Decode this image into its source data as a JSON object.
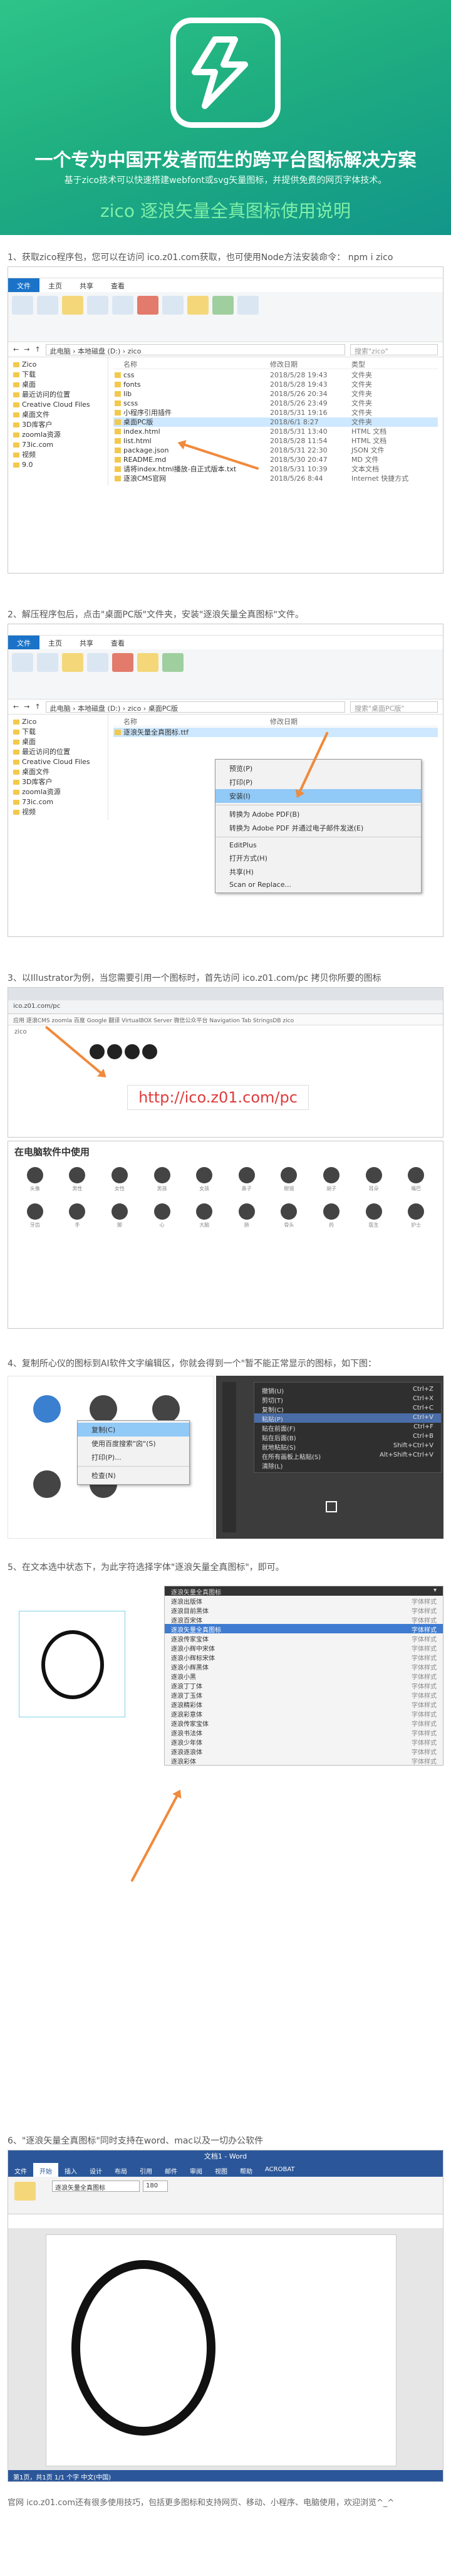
{
  "hero": {
    "title": "一个专为中国开发者而生的跨平台图标解决方案",
    "subtitle": "基于zico技术可以快速搭建webfont或svg矢量图标，并提供免费的网页字体技术。",
    "heading": "zico 逐浪矢量全真图标使用说明"
  },
  "steps": {
    "s1": "1、获取zico程序包，您可以在访问 ico.z01.com获取，也可使用Node方法安装命令： npm i zico",
    "s2": "2、解压程序包后，点击\"桌面PC版\"文件夹，安装\"逐浪矢量全真图标\"文件。",
    "s3": "3、以Illustrator为例，当您需要引用一个图标时，首先访问 ico.z01.com/pc 拷贝你所要的图标",
    "s4": "4、复制所心仪的图标到AI软件文字编辑区，你就会得到一个\"暂不能正常显示的图标，如下图：",
    "s5": "5、在文本选中状态下，为此字符选择字体\"逐浪矢量全真图标\"，即可。",
    "s6": "6、\"逐浪矢量全真图标\"同时支持在word、mac以及一切办公软件"
  },
  "explorer1": {
    "tabs": [
      "文件",
      "主页",
      "共享",
      "查看"
    ],
    "path": "此电脑 › 本地磁盘 (D:) › zico",
    "search": "搜索\"zico\"",
    "columns": [
      "名称",
      "修改日期",
      "类型"
    ],
    "nav": [
      "Zico",
      "下载",
      "桌面",
      "最近访问的位置",
      "Creative Cloud Files",
      "桌面文件",
      "3D库客户",
      "zoomla资源",
      "73ic.com",
      "视频",
      "9.0"
    ],
    "files": [
      {
        "name": "css",
        "date": "2018/5/28 19:43",
        "type": "文件夹"
      },
      {
        "name": "fonts",
        "date": "2018/5/28 19:43",
        "type": "文件夹"
      },
      {
        "name": "lib",
        "date": "2018/5/26 20:34",
        "type": "文件夹"
      },
      {
        "name": "scss",
        "date": "2018/5/26 23:49",
        "type": "文件夹"
      },
      {
        "name": "小程序引用插件",
        "date": "2018/5/31 19:16",
        "type": "文件夹"
      },
      {
        "name": "桌面PC版",
        "date": "2018/6/1 8:27",
        "type": "文件夹"
      },
      {
        "name": "index.html",
        "date": "2018/5/31 13:40",
        "type": "HTML 文档"
      },
      {
        "name": "list.html",
        "date": "2018/5/28 11:54",
        "type": "HTML 文档"
      },
      {
        "name": "package.json",
        "date": "2018/5/31 22:30",
        "type": "JSON 文件"
      },
      {
        "name": "README.md",
        "date": "2018/5/30 20:47",
        "type": "MD 文件"
      },
      {
        "name": "请将index.html播放-自正式版本.txt",
        "date": "2018/5/31 10:39",
        "type": "文本文档"
      },
      {
        "name": "逐浪CMS官网",
        "date": "2018/5/26 8:44",
        "type": "Internet 快捷方式"
      }
    ]
  },
  "explorer2": {
    "path": "此电脑 › 本地磁盘 (D:) › zico › 桌面PC版",
    "search": "搜索\"桌面PC版\"",
    "nav": [
      "Zico",
      "下载",
      "桌面",
      "最近访问的位置",
      "Creative Cloud Files",
      "桌面文件",
      "3D库客户",
      "zoomla资源",
      "73ic.com",
      "视频"
    ],
    "file": "逐浪矢量全真图标.ttf",
    "menu": [
      "预览(P)",
      "打印(P)",
      "安装(I)",
      "转换为 Adobe PDF(B)",
      "转换为 Adobe PDF 并通过电子邮件发送(E)",
      "EditPlus",
      "打开方式(H)",
      "共享(H)",
      "Scan or Replace..."
    ]
  },
  "browser": {
    "url": "ico.z01.com/pc",
    "bookmarks": "应用  逐浪CMS  zoomla  百度  Google 翻译  VirtualBOX Server  微信公众平台  Navigation Tab  StringsDB  zico",
    "badge": "http://ico.z01.com/pc",
    "section": "在电脑软件中使用",
    "icons": [
      "头像",
      "男性",
      "女性",
      "男孩",
      "女孩",
      "鼻子",
      "眼镜",
      "胡子",
      "耳朵",
      "嘴巴",
      "牙齿",
      "手",
      "脚",
      "心",
      "大脑",
      "肺",
      "骨头",
      "药",
      "医生",
      "护士"
    ]
  },
  "ai_menu": [
    "撤销(U)",
    "剪切(T)",
    "复制(C)",
    "粘贴(P)",
    "贴在前面(F)",
    "贴在后面(B)",
    "就地粘贴(S)",
    "在所有画板上粘贴(S)",
    "清除(L)"
  ],
  "ctx_small": [
    "复制(C)",
    "使用百度搜索\"囟\"(S)",
    "打印(P)...",
    "检查(N)"
  ],
  "fonts": {
    "selected": "逐浪矢量全真图标",
    "list": [
      "逐浪出版体",
      "逐浪目前黑体",
      "逐浪百宋体",
      "逐浪矢量全真图标",
      "逐浪传家宝体",
      "逐浪小辉中宋体",
      "逐浪小辉标宋体",
      "逐浪小辉黑体",
      "逐浪小黑",
      "逐浪丁丁体",
      "逐浪丁玉体",
      "逐浪精彩体",
      "逐浪彩意体",
      "逐浪传家宝体",
      "逐浪书法体",
      "逐浪少年体",
      "逐浪逐浪体",
      "逐浪彩体"
    ],
    "style": "字体样式"
  },
  "word": {
    "title": "文档1 - Word",
    "tabs": [
      "文件",
      "开始",
      "插入",
      "设计",
      "布局",
      "引用",
      "邮件",
      "审阅",
      "视图",
      "帮助",
      "ACROBAT"
    ],
    "font": "逐浪矢量全真图标",
    "size": "180",
    "status": "第1页，共1页    1/1 个字    中文(中国)"
  },
  "footer": "官网 ico.z01.com还有很多使用技巧，包括更多图标和支持网页、移动、小程序、电脑使用，欢迎浏览^_^"
}
